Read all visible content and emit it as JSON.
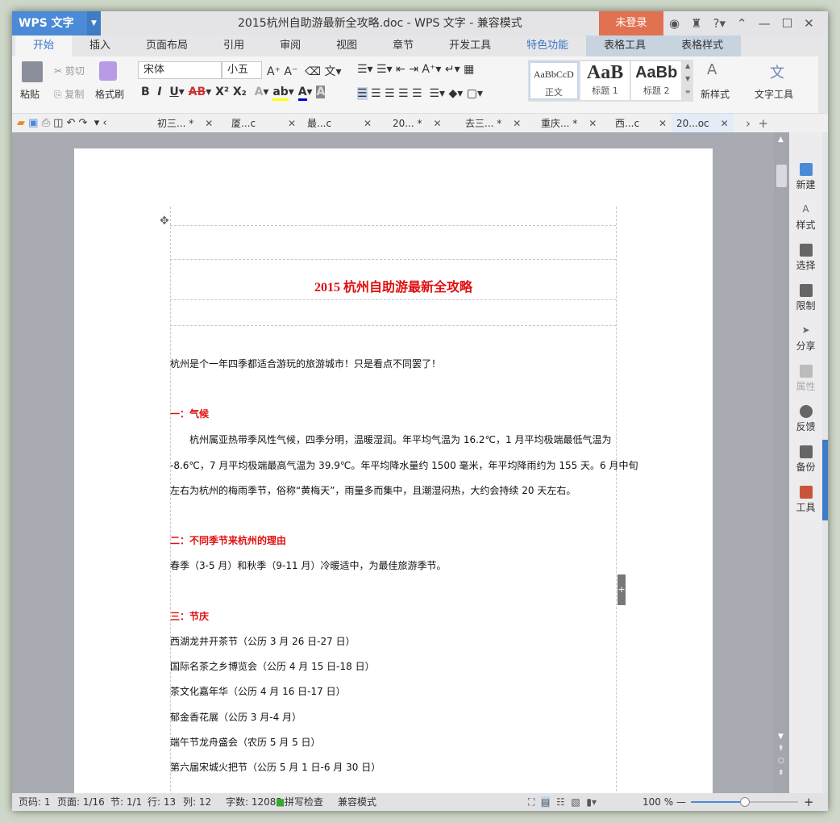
{
  "app": {
    "name": "WPS 文字",
    "title": "2015杭州自助游最新全攻略.doc - WPS 文字 - 兼容模式",
    "login": "未登录"
  },
  "tabs": [
    "开始",
    "插入",
    "页面布局",
    "引用",
    "审阅",
    "视图",
    "章节",
    "开发工具",
    "特色功能",
    "表格工具",
    "表格样式"
  ],
  "ribbon": {
    "paste": "粘贴",
    "cut": "剪切",
    "copy": "复制",
    "format_painter": "格式刷",
    "font": "宋体",
    "size": "小五",
    "styles": [
      {
        "preview": "AaBbCcD",
        "label": "正文"
      },
      {
        "preview": "AaB",
        "label": "标题 1"
      },
      {
        "preview": "AaBb",
        "label": "标题 2"
      }
    ],
    "new_style": "新样式",
    "text_tools": "文字工具"
  },
  "doc_tabs": [
    {
      "label": "初三... *"
    },
    {
      "label": "厦...c"
    },
    {
      "label": "最...c"
    },
    {
      "label": "20... *"
    },
    {
      "label": "去三... *"
    },
    {
      "label": "重庆... *"
    },
    {
      "label": "西...c"
    },
    {
      "label": "20...oc"
    }
  ],
  "document": {
    "title": "2015 杭州自助游最新全攻略",
    "intro": "杭州是个一年四季都适合游玩的旅游城市！只是看点不同罢了！",
    "h1": "一：气候",
    "climate": [
      "　　杭州属亚热带季风性气候，四季分明，温暖湿润。年平均气温为 16.2℃，1 月平均极端最低气温为",
      "-8.6℃，7 月平均极端最高气温为 39.9℃。年平均降水量约 1500 毫米，年平均降雨约为 155 天。6 月中旬",
      "左右为杭州的梅雨季节，俗称“黄梅天”，雨量多而集中，且潮湿闷热，大约会持续 20 天左右。"
    ],
    "h2": "二：不同季节来杭州的理由",
    "seasons": "春季（3-5 月）和秋季（9-11 月）冷暖适中，为最佳旅游季节。",
    "h3": "三：节庆",
    "festivals": [
      "西湖龙井开茶节（公历 3 月 26 日-27 日）",
      "国际名茶之乡博览会（公历 4 月 15 日-18 日）",
      "茶文化嘉年华（公历 4 月 16 日-17 日）",
      "郁金香花展（公历 3 月-4 月）",
      "端午节龙舟盛会（农历 5 月 5 日）",
      "第六届宋城火把节（公历 5 月 1 日-6 月 30 日）"
    ]
  },
  "right_panel": [
    "新建",
    "样式",
    "选择",
    "限制",
    "分享",
    "属性",
    "反馈",
    "备份",
    "工具"
  ],
  "status": {
    "page_no": "页码: 1",
    "pages": "页面: 1/16",
    "section": "节: 1/1",
    "row": "行: 13",
    "col": "列: 12",
    "words": "字数: 12083",
    "spell": "拼写检查",
    "mode": "兼容模式",
    "zoom": "100 %",
    "zoom_fraction": 0.5
  }
}
